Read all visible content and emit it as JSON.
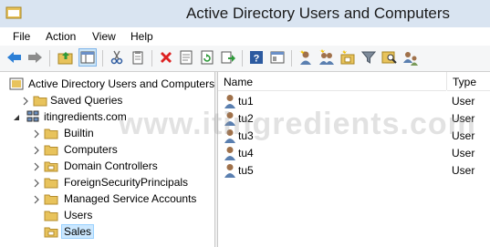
{
  "window": {
    "title": "Active Directory Users and Computers"
  },
  "menu": [
    "File",
    "Action",
    "View",
    "Help"
  ],
  "toolbar": {
    "buttons": [
      "back-icon",
      "forward-icon",
      "up-folder-icon",
      "show-console-tree-icon",
      "cut-icon",
      "copy-icon",
      "delete-icon",
      "properties-icon",
      "refresh-icon",
      "export-list-icon",
      "help-icon",
      "console-view-icon",
      "new-user-icon",
      "new-group-icon",
      "new-ou-icon",
      "filter-icon",
      "find-icon",
      "add-to-group-icon"
    ]
  },
  "tree": {
    "root": "Active Directory Users and Computers",
    "items": [
      {
        "label": "Saved Queries"
      },
      {
        "label": "itingredients.com"
      },
      {
        "label": "Builtin"
      },
      {
        "label": "Computers"
      },
      {
        "label": "Domain Controllers"
      },
      {
        "label": "ForeignSecurityPrincipals"
      },
      {
        "label": "Managed Service Accounts"
      },
      {
        "label": "Users"
      },
      {
        "label": "Sales"
      }
    ],
    "selected": "Sales"
  },
  "list": {
    "columns": [
      "Name",
      "Type"
    ],
    "rows": [
      {
        "name": "tu1",
        "type": "User"
      },
      {
        "name": "tu2",
        "type": "User"
      },
      {
        "name": "tu3",
        "type": "User"
      },
      {
        "name": "tu4",
        "type": "User"
      },
      {
        "name": "tu5",
        "type": "User"
      }
    ]
  },
  "watermark": "www.itingredients.com",
  "colors": {
    "titlebar": "#d9e4f1",
    "selection": "#cce8ff",
    "folder": "#e8c35c"
  }
}
